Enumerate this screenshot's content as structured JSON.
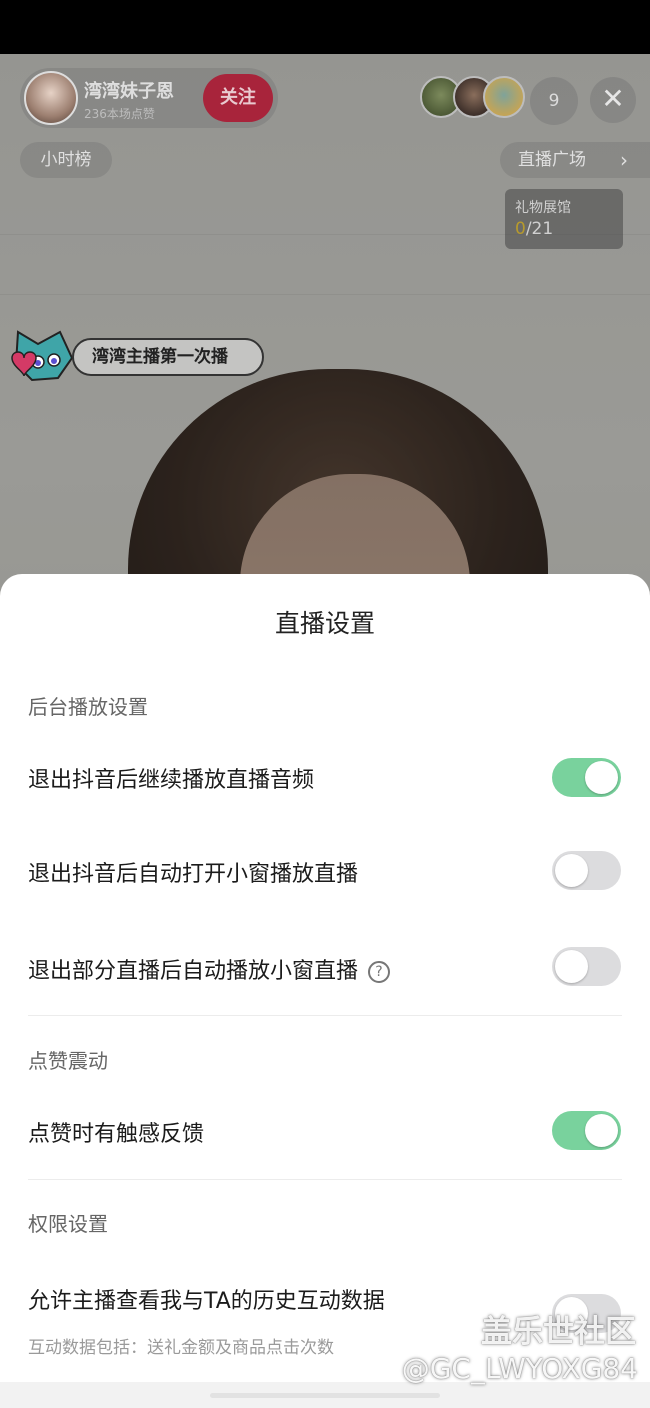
{
  "live": {
    "host_name": "湾湾妹子恩",
    "host_likes": "236本场点赞",
    "follow_label": "关注",
    "viewer_count": "9",
    "close_glyph": "✕",
    "rank_label": "小时榜",
    "plaza_label": "直播广场",
    "plaza_arrow": "›",
    "gift_title": "礼物展馆",
    "gift_current": "0",
    "gift_total": "/21",
    "banner_text": "湾湾主播第一次播"
  },
  "sheet": {
    "title": "直播设置",
    "sections": [
      {
        "header": "后台播放设置",
        "rows": [
          {
            "label": "退出抖音后继续播放直播音频",
            "on": true
          },
          {
            "label": "退出抖音后自动打开小窗播放直播",
            "on": false
          },
          {
            "label": "退出部分直播后自动播放小窗直播",
            "on": false,
            "help": "?"
          }
        ]
      },
      {
        "header": "点赞震动",
        "rows": [
          {
            "label": "点赞时有触感反馈",
            "on": true
          }
        ]
      },
      {
        "header": "权限设置",
        "rows": [
          {
            "label": "允许主播查看我与TA的历史互动数据",
            "on": false,
            "sub": "互动数据包括：送礼金额及商品点击次数"
          }
        ]
      }
    ]
  },
  "watermark": {
    "logo": "盖乐世社区",
    "id": "@GC_LWYOXG84"
  },
  "colors": {
    "toggle_on": "#79d29d",
    "toggle_off": "#dcdcde",
    "follow": "#e0304e"
  }
}
